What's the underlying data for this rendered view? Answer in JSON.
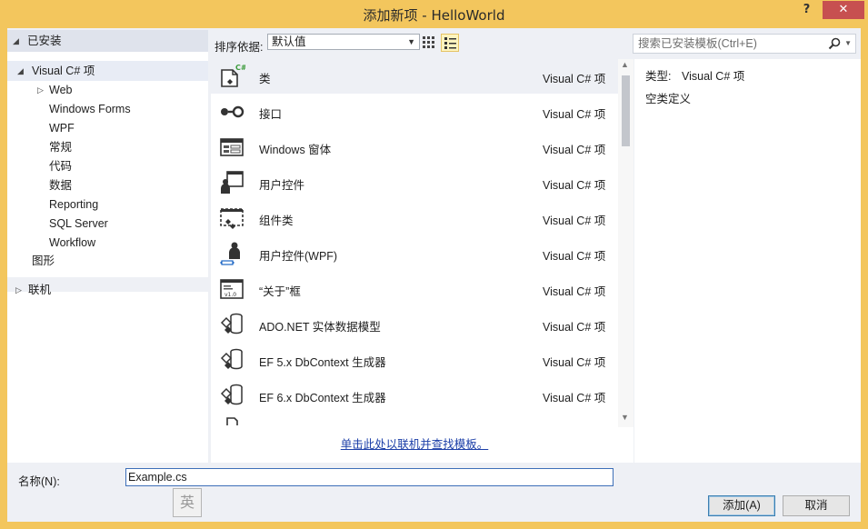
{
  "window": {
    "title": "添加新项 - HelloWorld",
    "help_label": "?",
    "close_label": "✕"
  },
  "tree": {
    "header": "已安装",
    "root": "Visual C# 项",
    "web": "Web",
    "children": [
      "Windows Forms",
      "WPF",
      "常规",
      "代码",
      "数据",
      "Reporting",
      "SQL Server",
      "Workflow"
    ],
    "graphics": "图形",
    "online": "联机"
  },
  "toolbar": {
    "sort_label": "排序依据:",
    "sort_value": "默认值"
  },
  "search": {
    "placeholder": "搜索已安装模板(Ctrl+E)"
  },
  "templates": [
    {
      "name": "类",
      "type": "Visual C# 项",
      "icon": "class-icon"
    },
    {
      "name": "接口",
      "type": "Visual C# 项",
      "icon": "interface-icon"
    },
    {
      "name": "Windows 窗体",
      "type": "Visual C# 项",
      "icon": "windows-form-icon"
    },
    {
      "name": "用户控件",
      "type": "Visual C# 项",
      "icon": "user-control-icon"
    },
    {
      "name": "组件类",
      "type": "Visual C# 项",
      "icon": "component-class-icon"
    },
    {
      "name": "用户控件(WPF)",
      "type": "Visual C# 项",
      "icon": "wpf-user-control-icon"
    },
    {
      "name": "“关于”框",
      "type": "Visual C# 项",
      "icon": "about-box-icon"
    },
    {
      "name": "ADO.NET 实体数据模型",
      "type": "Visual C# 项",
      "icon": "entity-model-icon"
    },
    {
      "name": "EF 5.x DbContext 生成器",
      "type": "Visual C# 项",
      "icon": "dbcontext-generator-icon"
    },
    {
      "name": "EF 6.x DbContext 生成器",
      "type": "Visual C# 项",
      "icon": "dbcontext-generator-icon"
    }
  ],
  "online_link": "单击此处以联机并查找模板。",
  "details": {
    "type_label": "类型:",
    "type_value": "Visual C# 项",
    "description": "空类定义"
  },
  "name_field": {
    "label": "名称(N):",
    "value": "Example.cs"
  },
  "ime_indicator": "英",
  "buttons": {
    "add": "添加(A)",
    "cancel": "取消"
  },
  "colors": {
    "frame": "#f3c65d",
    "close": "#c75050",
    "link": "#1c3fa8",
    "focus": "#3d6fb8"
  }
}
